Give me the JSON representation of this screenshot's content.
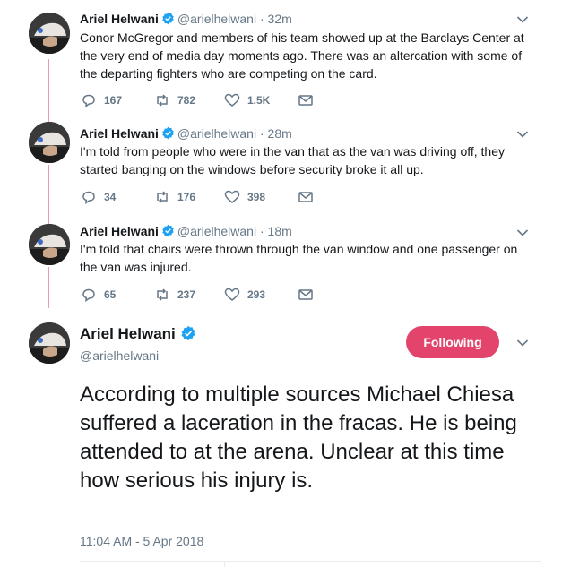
{
  "account": {
    "name": "Ariel Helwani",
    "handle": "@arielhelwani"
  },
  "tweets": [
    {
      "time": "32m",
      "text": "Conor McGregor and members of his team showed up at the Barclays Center at the very end of media day moments ago. There was an altercation with some of the departing fighters who are competing on the card.",
      "replies": "167",
      "retweets": "782",
      "likes": "1.5K"
    },
    {
      "time": "28m",
      "text": "I'm told from people who were in the van that as the van was driving off, they started banging on the windows  before security broke it all up.",
      "replies": "34",
      "retweets": "176",
      "likes": "398"
    },
    {
      "time": "18m",
      "text": "I'm told that chairs were thrown through the van window and one passenger on the van was injured.",
      "replies": "65",
      "retweets": "237",
      "likes": "293"
    }
  ],
  "main_tweet": {
    "follow_label": "Following",
    "text": "According to multiple sources Michael Chiesa suffered a laceration in the fracas. He is being attended to at the arena. Unclear at this time how serious his injury is.",
    "timestamp": "11:04 AM - 5 Apr 2018"
  },
  "icons": {
    "verified": "verified-badge-icon",
    "reply": "reply-icon",
    "retweet": "retweet-icon",
    "like": "heart-icon",
    "dm": "envelope-icon",
    "menu": "chevron-down-icon"
  },
  "colors": {
    "thread_line": "#e89fb2",
    "follow_button": "#e2446c",
    "verified": "#1da1f2",
    "muted": "#657786"
  }
}
